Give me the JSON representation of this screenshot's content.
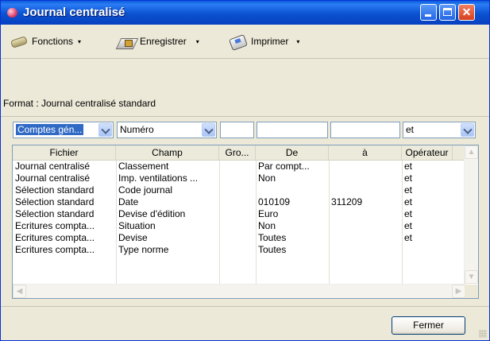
{
  "window": {
    "title": "Journal centralisé"
  },
  "toolbar": {
    "functions_label": "Fonctions",
    "save_label": "Enregistrer",
    "print_label": "Imprimer",
    "arrow": "▾"
  },
  "format_text": "Format : Journal centralisé standard",
  "filters": {
    "account_select": "Comptes gén...",
    "field_select": "Numéro",
    "group_value": "",
    "from_value": "",
    "to_value": "",
    "operator_select": "et"
  },
  "table": {
    "columns": [
      "Fichier",
      "Champ",
      "Gro...",
      "De",
      "à",
      "Opérateur"
    ],
    "rows": [
      [
        "Journal centralisé",
        "Classement",
        "",
        "Par compt...",
        "",
        "et"
      ],
      [
        "Journal centralisé",
        "Imp. ventilations ...",
        "",
        "Non",
        "",
        "et"
      ],
      [
        "Sélection standard",
        "Code journal",
        "",
        "",
        "",
        "et"
      ],
      [
        "Sélection standard",
        "Date",
        "",
        "010109",
        "311209",
        "et"
      ],
      [
        "Sélection standard",
        "Devise d'édition",
        "",
        "Euro",
        "",
        "et"
      ],
      [
        "Ecritures compta...",
        "Situation",
        "",
        "Non",
        "",
        "et"
      ],
      [
        "Ecritures compta...",
        "Devise",
        "",
        "Toutes",
        "",
        "et"
      ],
      [
        "Ecritures compta...",
        "Type norme",
        "",
        "Toutes",
        "",
        ""
      ]
    ]
  },
  "close_button": "Fermer"
}
